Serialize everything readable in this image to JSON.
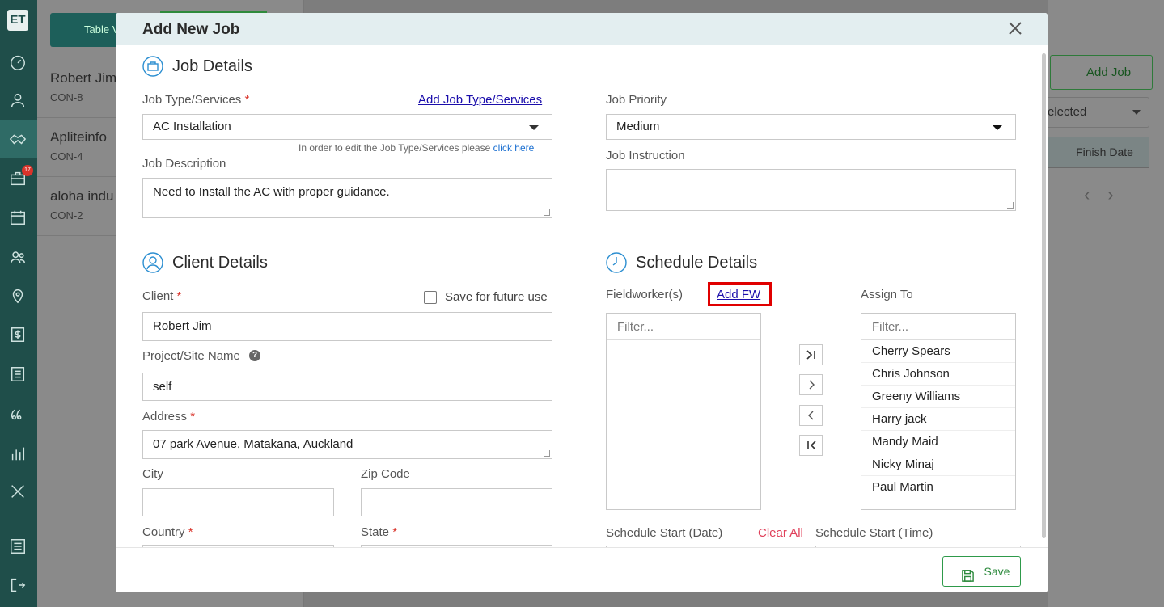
{
  "app": {
    "logo": "ET",
    "sidebar": {
      "icons": [
        "dashboard-icon",
        "user-icon",
        "handshake-icon",
        "briefcase-icon",
        "calendar-icon",
        "users-icon",
        "map-pin-icon",
        "dollar-icon",
        "list-icon",
        "chat-icon",
        "chart-icon",
        "tools-icon",
        "settings-icon",
        "logout-icon"
      ],
      "badge": "17"
    },
    "background": {
      "toolbar_btn": "Table V",
      "items": [
        {
          "name": "Robert Jim",
          "code": "CON-8"
        },
        {
          "name": "Apliteinfo",
          "code": "CON-4"
        },
        {
          "name": "aloha indu",
          "code": "CON-2"
        }
      ],
      "add_job": "Add Job",
      "selected": "elected",
      "finish_date": "Finish Date"
    }
  },
  "modal": {
    "title": "Add New Job",
    "job_details": {
      "title": "Job Details",
      "job_type_label": "Job Type/Services",
      "add_job_type_link": "Add Job Type/Services",
      "job_type_value": "AC Installation",
      "hint_text": "In order to edit the Job Type/Services please",
      "hint_link": "click here",
      "job_description_label": "Job Description",
      "job_description_value": "Need to Install the AC with proper guidance.",
      "job_priority_label": "Job Priority",
      "job_priority_value": "Medium",
      "job_instruction_label": "Job Instruction",
      "job_instruction_value": ""
    },
    "client_details": {
      "title": "Client Details",
      "client_label": "Client",
      "save_future_label": "Save for future use",
      "client_value": "Robert Jim",
      "project_label": "Project/Site Name",
      "project_value": "self",
      "address_label": "Address",
      "address_value": "07 park Avenue, Matakana, Auckland",
      "city_label": "City",
      "city_value": "",
      "zip_label": "Zip Code",
      "zip_value": "",
      "country_label": "Country",
      "state_label": "State"
    },
    "schedule_details": {
      "title": "Schedule Details",
      "fieldworkers_label": "Fieldworker(s)",
      "add_fw_link": "Add FW",
      "assign_to_label": "Assign To",
      "filter_placeholder": "Filter...",
      "fieldworkers": [],
      "assign_to": [
        "Cherry Spears",
        "Chris Johnson",
        "Greeny Williams",
        "Harry jack",
        "Mandy Maid",
        "Nicky Minaj",
        "Paul Martin"
      ],
      "start_date_label": "Schedule Start (Date)",
      "clear_all": "Clear All",
      "start_time_label": "Schedule Start (Time)"
    },
    "footer": {
      "save_label": "Save"
    }
  },
  "colors": {
    "accent": "#1f4e4a",
    "required": "#d9342b",
    "link": "#1a0dab",
    "save": "#2e8b3e",
    "highlight": "#e00000"
  }
}
